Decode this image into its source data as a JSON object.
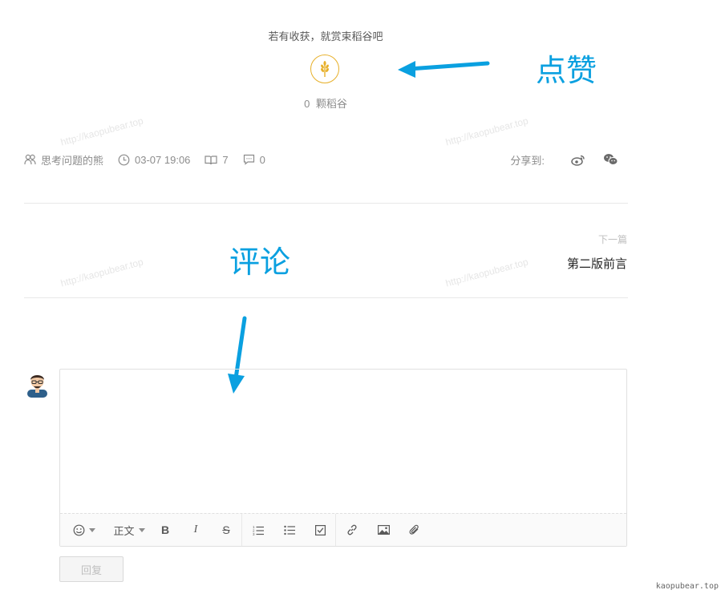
{
  "reward": {
    "tip": "若有收获，就赏束稻谷吧",
    "count": "0",
    "unit": "颗稻谷",
    "icon": "wheat-icon",
    "accent": "#e7b02a"
  },
  "meta": {
    "author": "思考问题的熊",
    "time": "03-07 19:06",
    "reads": "7",
    "comments": "0"
  },
  "share": {
    "label": "分享到:",
    "icons": [
      "weibo-icon",
      "wechat-icon"
    ]
  },
  "next": {
    "label": "下一篇",
    "title": "第二版前言"
  },
  "annotations": {
    "like": "点赞",
    "comment": "评论",
    "color": "#0aa0e0"
  },
  "watermark": "http://kaopubear.top",
  "editor": {
    "toolbar": {
      "emoji": "emoji-icon",
      "paragraph": "正文",
      "bold": "B",
      "italic": "I",
      "strike": "S"
    },
    "submit": "回复"
  },
  "site_mark": "kaopubear.top"
}
